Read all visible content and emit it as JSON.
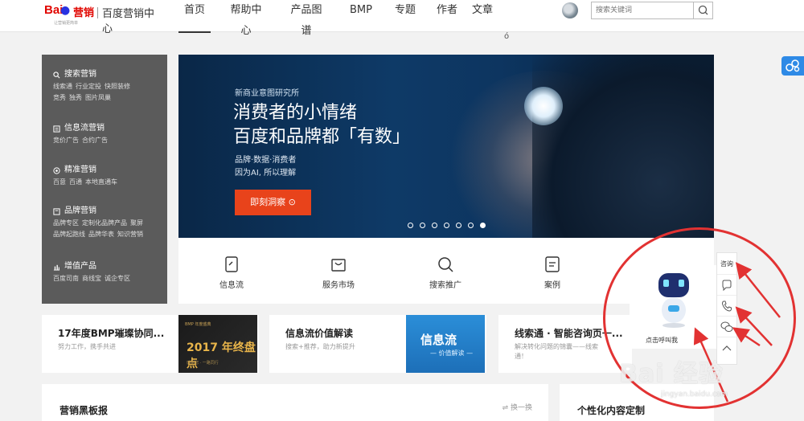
{
  "brand": {
    "logo_bai": "Bai",
    "logo_ying": "营销",
    "site_title": "百度营销中心",
    "slogan": "让营销更简单"
  },
  "nav": {
    "items": [
      {
        "label": "首页",
        "active": true
      },
      {
        "label": "帮助中心",
        "active": false
      },
      {
        "label": "产品图谱",
        "active": false
      },
      {
        "label": "BMP",
        "active": false
      },
      {
        "label": "专题",
        "active": false
      },
      {
        "label": "作者",
        "active": false
      },
      {
        "label": "文章",
        "active": false
      }
    ]
  },
  "search": {
    "placeholder": "搜索关键词",
    "button_icon": "search-icon"
  },
  "marker_char": "ó",
  "side_menu": {
    "groups": [
      {
        "title": "搜索营销",
        "icon": "search-icon",
        "links": [
          "线索通",
          "行业定投",
          "快照装修",
          "竞秀",
          "独秀",
          "图片凤巢"
        ]
      },
      {
        "title": "信息流营销",
        "icon": "feed-icon",
        "links": [
          "竞价广告",
          "合约广告"
        ]
      },
      {
        "title": "精准营销",
        "icon": "target-icon",
        "links": [
          "百意",
          "百通",
          "本地直通车"
        ]
      },
      {
        "title": "品牌营销",
        "icon": "brand-icon",
        "links": [
          "品牌专区",
          "定制化品牌产品",
          "聚屏",
          "品牌起跑线",
          "品牌华表",
          "知识营销"
        ]
      },
      {
        "title": "增值产品",
        "icon": "chart-icon",
        "links": [
          "百度司南",
          "商线宝",
          "诚企专区"
        ]
      }
    ]
  },
  "banner": {
    "kicker": "新商业意图研究所",
    "headline_line1": "消费者的小情绪",
    "headline_line2": "百度和品牌都「有数」",
    "sub_line1": "品牌·数据·消费者",
    "sub_line2": "因为AI, 所以理解",
    "cta_label": "即刻洞察 ⊙",
    "dots_total": 7,
    "active_dot": 6
  },
  "services": [
    {
      "label": "信息流",
      "icon": "tablet-icon"
    },
    {
      "label": "服务市场",
      "icon": "bag-icon"
    },
    {
      "label": "搜索推广",
      "icon": "search-icon"
    },
    {
      "label": "案例",
      "icon": "document-icon"
    }
  ],
  "cards": [
    {
      "title": "17年度BMP璀璨协同...",
      "desc": "努力工作，携手共进",
      "thumb_top": "BMP 年度盛典",
      "thumb_main": "2017 年终盘点",
      "thumb_bottom": "感谢您 · 一路同行"
    },
    {
      "title": "信息流价值解读",
      "desc": "搜索+推荐，助力新提升",
      "thumb_main": "信息流",
      "thumb_sub": "— 价值解读 —"
    },
    {
      "title": "线索通 · 智能咨询页一...",
      "desc_line1": "解决转化问题的锦囊——线索",
      "desc_line2": "通！"
    }
  ],
  "bottom_a": {
    "title": "营销黑板报",
    "swap_label": "⇌ 换一换"
  },
  "bottom_b": {
    "title": "个性化内容定制"
  },
  "popup": {
    "caption": "点击呼叫我"
  },
  "float_bar": {
    "items": [
      {
        "label": "咨询",
        "icon": ""
      },
      {
        "label": "",
        "icon": "message-icon"
      },
      {
        "label": "",
        "icon": "phone-icon"
      },
      {
        "label": "",
        "icon": "wechat-icon"
      },
      {
        "label": "",
        "icon": "chevron-up-icon"
      }
    ]
  },
  "watermark": {
    "text": "Bai 经验",
    "url": "jingyan.baidu.com"
  },
  "colors": {
    "brand_red": "#e10601",
    "brand_blue": "#2932e1",
    "cta": "#e8431b",
    "annotation": "#e23232"
  }
}
